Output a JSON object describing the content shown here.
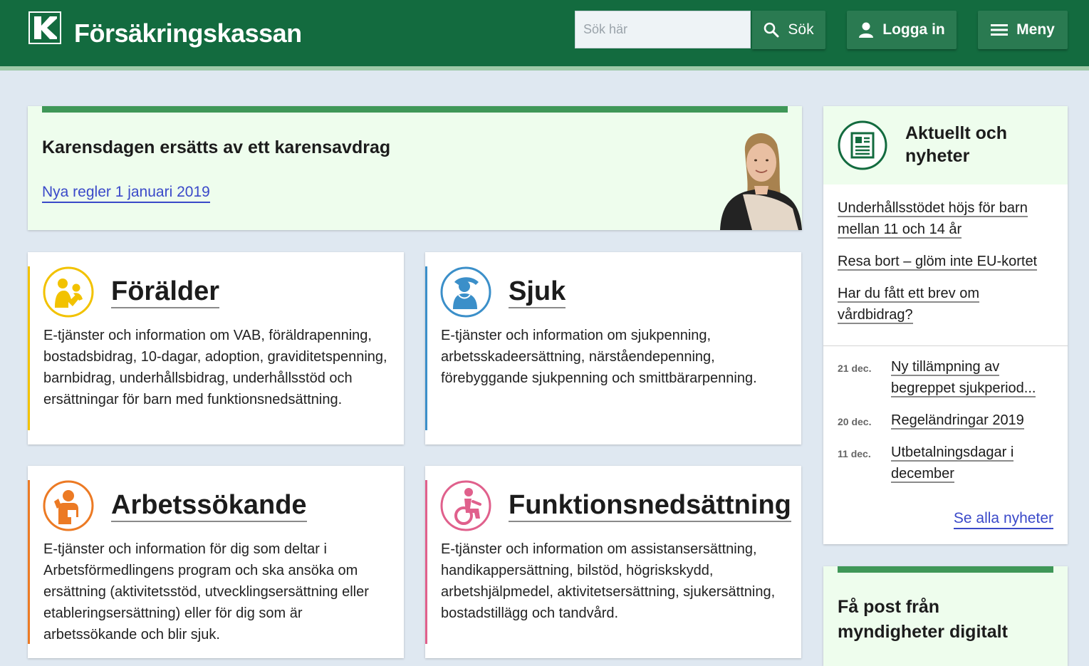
{
  "header": {
    "logo_text": "Försäkringskassan",
    "search_placeholder": "Sök här",
    "search_label": "Sök",
    "login_label": "Logga in",
    "menu_label": "Meny"
  },
  "hero": {
    "title": "Karensdagen ersätts av ett karensavdrag",
    "link": "Nya regler 1 januari 2019"
  },
  "categories": [
    {
      "title": "Förälder",
      "accent": "#f2c200",
      "description": "E-tjänster och information om VAB, föräldrapenning, bostadsbidrag, 10-dagar, adoption, graviditetspenning, barnbidrag, underhållsbidrag, underhållsstöd och ersättningar för barn med funktionsnedsättning."
    },
    {
      "title": "Sjuk",
      "accent": "#3b8fc9",
      "description": "E-tjänster och information om sjukpenning, arbetsskadeersättning, närståendepenning, förebyggande sjukpenning och smittbärarpenning."
    },
    {
      "title": "Arbetssökande",
      "accent": "#ec7a24",
      "description": "E-tjänster och information för dig som deltar i Arbetsförmedlingens program och ska ansöka om ersättning (aktivitetsstöd, utvecklingsersättning eller etableringsersättning) eller för dig som är arbetssökande och blir sjuk."
    },
    {
      "title": "Funktionsnedsättning",
      "accent": "#e0608c",
      "description": "E-tjänster och information om assistansersättning, handikappersättning, bilstöd, högriskskydd, arbetshjälpmedel, aktivitetsersättning, sjukersättning, bostadstillägg och tandvård."
    }
  ],
  "news": {
    "title": "Aktuellt och nyheter",
    "featured": [
      "Underhållsstödet höjs för barn mellan 11 och 14 år",
      "Resa bort – glöm inte EU-kortet",
      "Har du fått ett brev om vårdbidrag?"
    ],
    "items": [
      {
        "date": "21 dec.",
        "title": "Ny tillämpning av begreppet sjukperiod..."
      },
      {
        "date": "20 dec.",
        "title": "Regeländringar 2019"
      },
      {
        "date": "11 dec.",
        "title": "Utbetalningsdagar i december"
      }
    ],
    "see_all": "Se alla nyheter"
  },
  "post": {
    "title": "Få post från myndigheter digitalt"
  },
  "colors": {
    "header_green": "#136b3f",
    "link_blue": "#3a49c9",
    "accent_green": "#3f9758"
  }
}
